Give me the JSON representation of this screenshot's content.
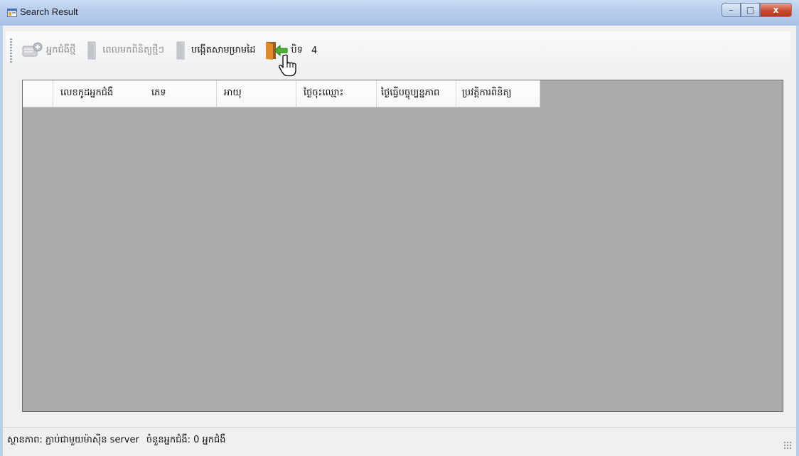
{
  "window": {
    "title": "Search Result",
    "buttons": {
      "minimize": "–",
      "maximize": "□",
      "close": "x"
    }
  },
  "toolbar": {
    "items": [
      {
        "label": "អ្នកជំងឺថ្មី",
        "icon": "add-patient-icon",
        "enabled": false
      },
      {
        "label": "ពេលមកពិនិត្យថ្មីៗ",
        "icon": "door-icon",
        "enabled": false
      },
      {
        "label": "បង្កើតសាមម្រាមដៃ",
        "icon": "door-icon",
        "enabled": true
      },
      {
        "label": "បិទ",
        "icon": "exit-door-icon",
        "enabled": true
      },
      {
        "label": "4",
        "icon": "",
        "enabled": true
      }
    ]
  },
  "grid": {
    "columns": [
      "លេខកូដអ្នកជំងឺ",
      "ភេទ",
      "អាយុ",
      "ថ្ងៃចុះឈ្មោះ",
      "ថ្ងៃធ្វើបច្ចុប្បន្នភាព",
      "ប្រវត្តិការពិនិត្យ"
    ],
    "rows": []
  },
  "status": {
    "text": "ស្ថានភាព: ភ្ជាប់ជាមួយម៉ាស៊ីន server",
    "count_text": "ចំនួនអ្នកជំងឺ: 0 អ្នកជំងឺ"
  },
  "colors": {
    "grid_background": "#ababab",
    "titlebar": "#b6cdec",
    "close_button": "#c9492d"
  }
}
